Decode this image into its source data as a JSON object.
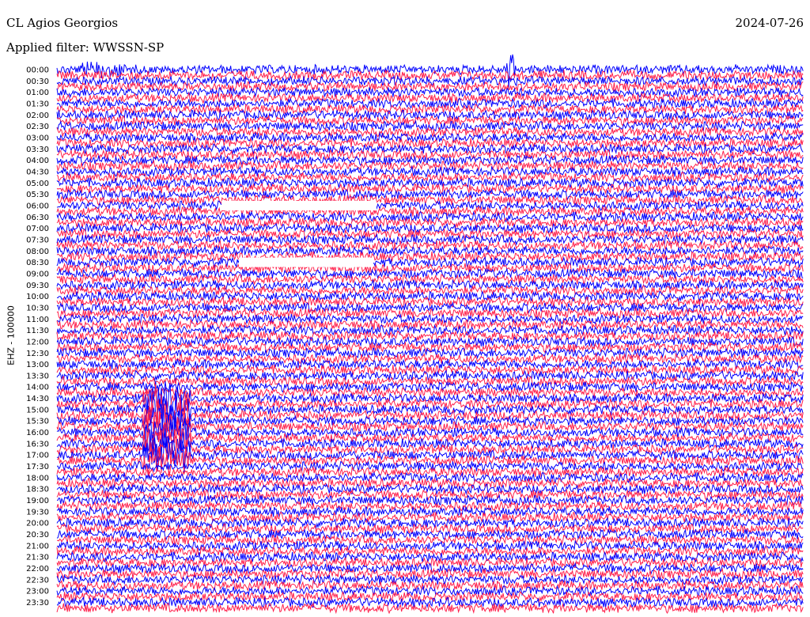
{
  "header": {
    "station": "CL Agios Georgios",
    "filter_label": "Applied filter: WWSSN-SP",
    "date": "2024-07-26"
  },
  "chart_data": {
    "type": "line",
    "title": "CL Agios Georgios",
    "subtitle": "Applied filter: WWSSN-SP",
    "date": "2024-07-26",
    "ylabel": "EHZ - 100000",
    "y_tick_labels": [
      "00:00",
      "00:30",
      "01:00",
      "01:30",
      "02:00",
      "02:30",
      "03:00",
      "03:30",
      "04:00",
      "04:30",
      "05:00",
      "05:30",
      "06:00",
      "06:30",
      "07:00",
      "07:30",
      "08:00",
      "08:30",
      "09:00",
      "09:30",
      "10:00",
      "10:30",
      "11:00",
      "11:30",
      "12:00",
      "12:30",
      "13:00",
      "13:30",
      "14:00",
      "14:30",
      "15:00",
      "15:30",
      "16:00",
      "16:30",
      "17:00",
      "17:30",
      "18:00",
      "18:30",
      "19:00",
      "19:30",
      "20:00",
      "20:30",
      "21:00",
      "21:30",
      "22:00",
      "22:30",
      "23:00",
      "23:30"
    ],
    "trace_colors": [
      "#0000ff",
      "#ff1f4b"
    ],
    "grid": false,
    "notable_events": [
      {
        "trace": "00:00",
        "kind": "spike"
      },
      {
        "trace": "16:00",
        "kind": "large burst"
      },
      {
        "trace": "06:00",
        "kind": "data gap"
      },
      {
        "trace": "08:30",
        "kind": "data gap"
      }
    ]
  }
}
